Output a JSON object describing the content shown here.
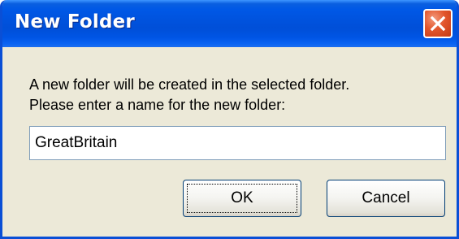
{
  "dialog": {
    "title": "New Folder",
    "message_line1": "A new folder will be created in the selected folder.",
    "message_line2": "Please enter a name for the new folder:",
    "folder_name_value": "GreatBritain",
    "ok_label": "OK",
    "cancel_label": "Cancel",
    "close_icon": "close-x-icon"
  },
  "colors": {
    "titlebar_blue": "#0052dd",
    "dialog_background": "#ece9d8",
    "close_button_red": "#e2562c"
  }
}
